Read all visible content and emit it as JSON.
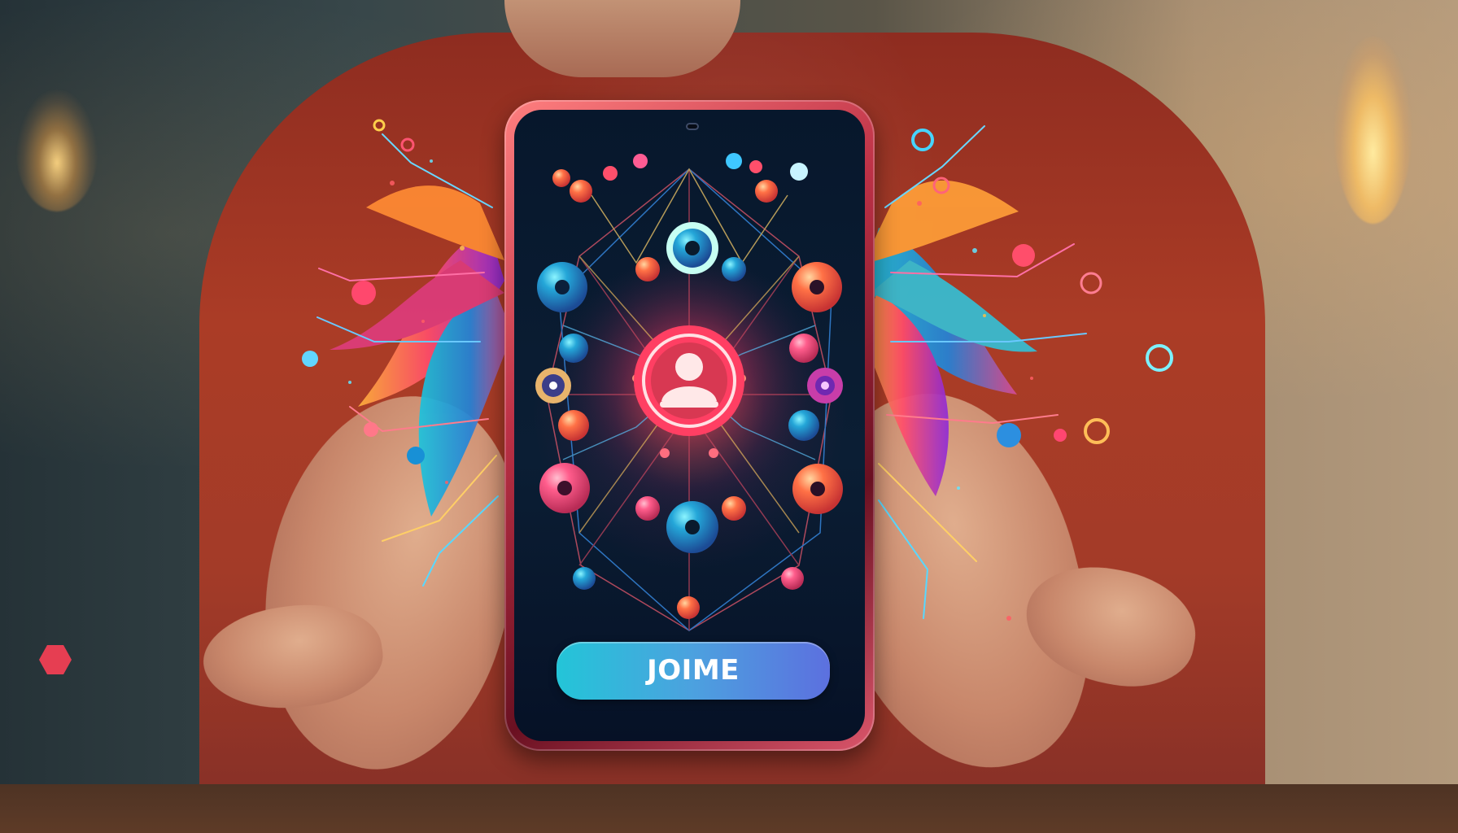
{
  "app": {
    "join_button_label": "JOIME"
  },
  "icons": {
    "profile": "profile-icon",
    "camera": "camera-icon"
  },
  "colors": {
    "shirt": "#9f3c2a",
    "phone_screen": "#0b1e34",
    "button_start": "#23c5d8",
    "button_end": "#5c70df",
    "profile_button": "#d83852"
  }
}
